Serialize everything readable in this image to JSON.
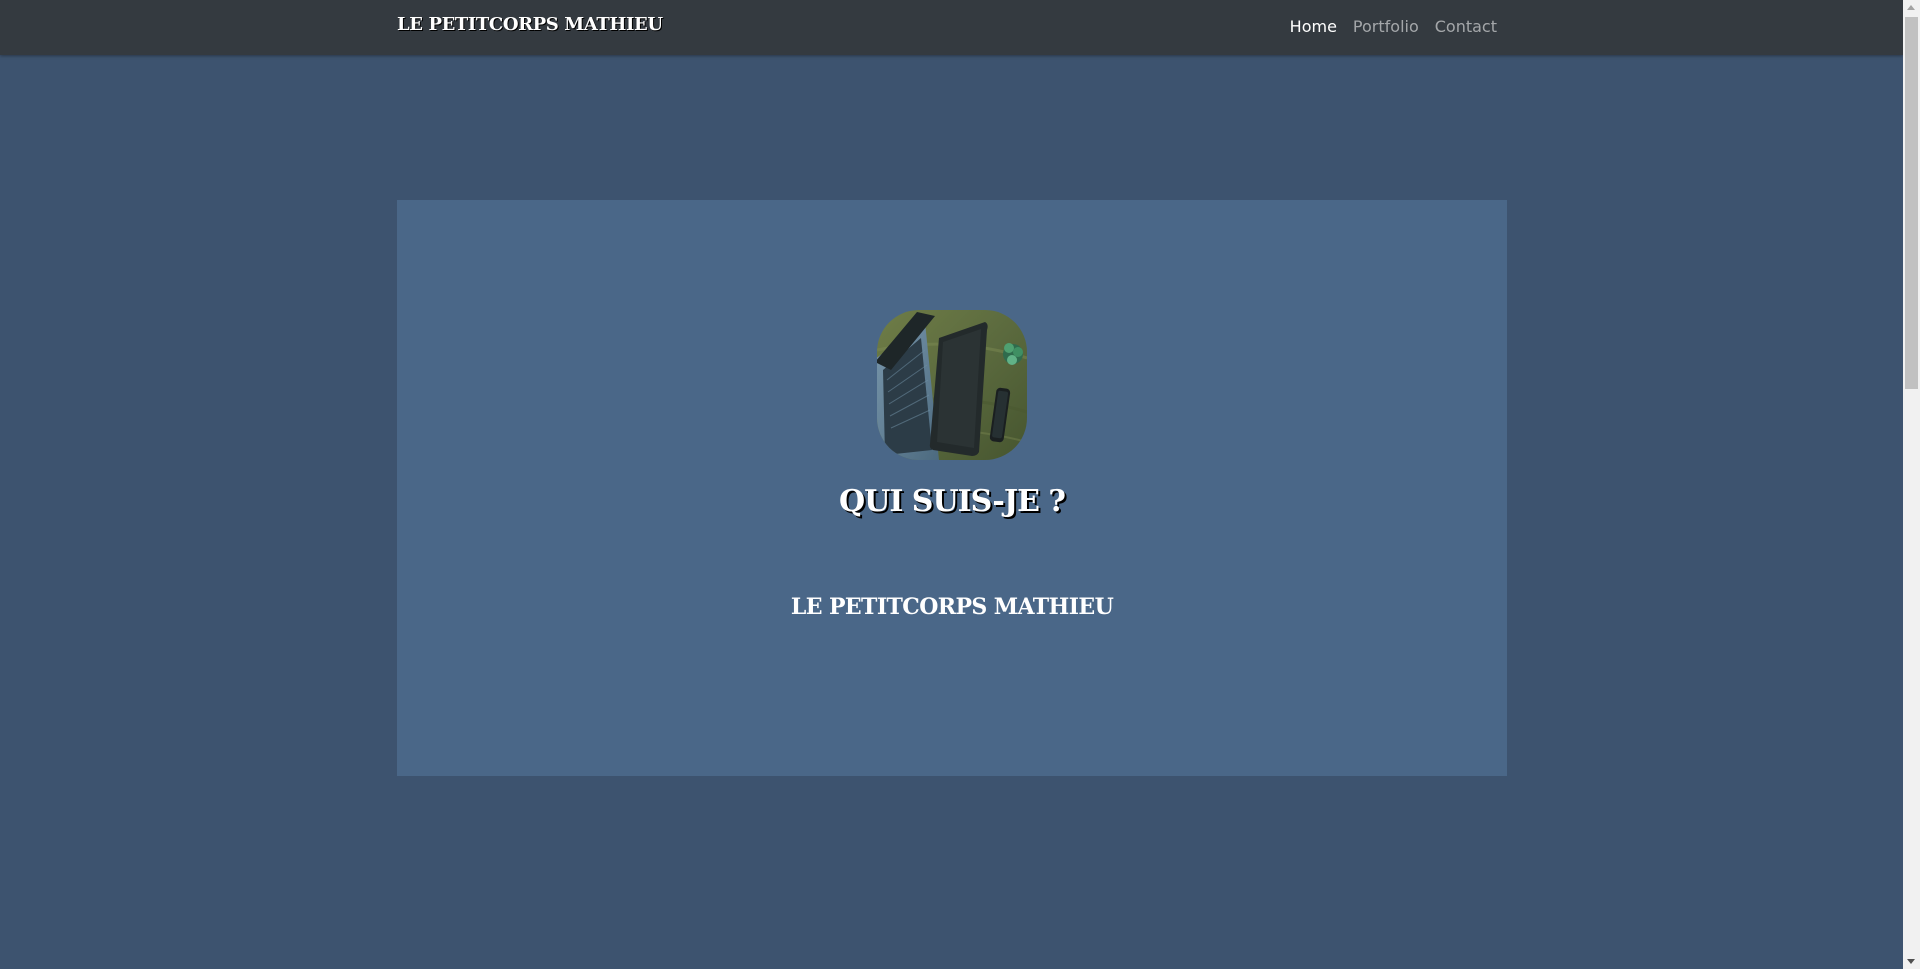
{
  "navbar": {
    "brand": "LE PETITCORPS MATHIEU",
    "links": [
      {
        "label": "Home",
        "active": true
      },
      {
        "label": "Portfolio",
        "active": false
      },
      {
        "label": "Contact",
        "active": false
      }
    ]
  },
  "hero": {
    "avatar_icon": "laptop-desk-photo",
    "title": "QUI SUIS-JE ?",
    "name": "LE PETITCORPS MATHIEU"
  },
  "colors": {
    "page_background": "#3d536f",
    "navbar_background": "#343a40",
    "card_background": "#4a6788",
    "text": "#ffffff",
    "inactive_link": "rgba(255,255,255,0.55)"
  }
}
